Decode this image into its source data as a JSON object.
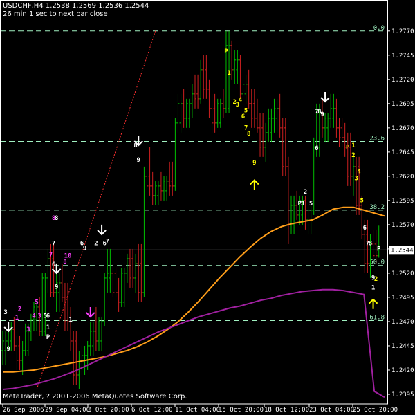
{
  "header": {
    "symbol_line": "USDCHF,H4  1.2538 1.2569 1.2536 1.2544",
    "timer": "26 min 1 sec to next bar close"
  },
  "footer": {
    "copyright": "MetaTrader, ? 2001-2006 MetaQuotes Software Corp."
  },
  "colors": {
    "background": "#000000",
    "grid": "#ffffff",
    "bull_bar": "#00c000",
    "bear_bar": "#d02020",
    "ma_fast": "#ff9e1a",
    "ma_slow": "#a020a0",
    "fib_line": "#a0f0c0",
    "trendline": "#ff3030",
    "label_yellow": "#ffff00",
    "label_white": "#ffffff",
    "label_magenta": "#ff40ff"
  },
  "chart_data": {
    "type": "candlestick",
    "symbol": "USDCHF",
    "timeframe": "H4",
    "current_price": "1.2544",
    "ylim": [
      1.2385,
      1.2782
    ],
    "y_ticks": [
      "1.2770",
      "1.2745",
      "1.2720",
      "1.2695",
      "1.2670",
      "1.2645",
      "1.2620",
      "1.2595",
      "1.2570",
      "1.2545",
      "1.2520",
      "1.2495",
      "1.2470",
      "1.2445",
      "1.2420",
      "1.2395"
    ],
    "x_ticks": [
      "26 Sep 2006",
      "29 Sep 04:00",
      "3 Oct 20:00",
      "6 Oct 12:00",
      "11 Oct 04:00",
      "15 Oct 20:00",
      "18 Oct 12:00",
      "23 Oct 04:00",
      "25 Oct 20:00"
    ],
    "fibonacci_levels": [
      {
        "label": "0.0",
        "price": 1.277
      },
      {
        "label": "23.6",
        "price": 1.2656
      },
      {
        "label": "38.2",
        "price": 1.2585
      },
      {
        "label": "50.0",
        "price": 1.2528
      },
      {
        "label": "61.8",
        "price": 1.2471
      }
    ],
    "current_price_line": 1.2544,
    "bars": [
      {
        "o": 1.244,
        "h": 1.246,
        "l": 1.2425,
        "c": 1.245
      },
      {
        "o": 1.245,
        "h": 1.247,
        "l": 1.244,
        "c": 1.2462
      },
      {
        "o": 1.2462,
        "h": 1.2475,
        "l": 1.244,
        "c": 1.2445
      },
      {
        "o": 1.2445,
        "h": 1.2455,
        "l": 1.242,
        "c": 1.243
      },
      {
        "o": 1.243,
        "h": 1.245,
        "l": 1.2415,
        "c": 1.244
      },
      {
        "o": 1.244,
        "h": 1.2468,
        "l": 1.2435,
        "c": 1.246
      },
      {
        "o": 1.246,
        "h": 1.2478,
        "l": 1.245,
        "c": 1.2472
      },
      {
        "o": 1.2472,
        "h": 1.249,
        "l": 1.246,
        "c": 1.2485
      },
      {
        "o": 1.2485,
        "h": 1.2495,
        "l": 1.2455,
        "c": 1.246
      },
      {
        "o": 1.246,
        "h": 1.252,
        "l": 1.2455,
        "c": 1.2515
      },
      {
        "o": 1.2515,
        "h": 1.2545,
        "l": 1.25,
        "c": 1.2535
      },
      {
        "o": 1.2535,
        "h": 1.255,
        "l": 1.2495,
        "c": 1.25
      },
      {
        "o": 1.25,
        "h": 1.252,
        "l": 1.248,
        "c": 1.251
      },
      {
        "o": 1.251,
        "h": 1.253,
        "l": 1.249,
        "c": 1.2495
      },
      {
        "o": 1.2495,
        "h": 1.251,
        "l": 1.246,
        "c": 1.247
      },
      {
        "o": 1.247,
        "h": 1.2485,
        "l": 1.244,
        "c": 1.245
      },
      {
        "o": 1.245,
        "h": 1.246,
        "l": 1.2405,
        "c": 1.2415
      },
      {
        "o": 1.2415,
        "h": 1.244,
        "l": 1.24,
        "c": 1.243
      },
      {
        "o": 1.243,
        "h": 1.2445,
        "l": 1.2415,
        "c": 1.2435
      },
      {
        "o": 1.2435,
        "h": 1.245,
        "l": 1.242,
        "c": 1.2445
      },
      {
        "o": 1.2445,
        "h": 1.247,
        "l": 1.2435,
        "c": 1.246
      },
      {
        "o": 1.246,
        "h": 1.2485,
        "l": 1.244,
        "c": 1.245
      },
      {
        "o": 1.245,
        "h": 1.2475,
        "l": 1.244,
        "c": 1.247
      },
      {
        "o": 1.247,
        "h": 1.252,
        "l": 1.2465,
        "c": 1.2515
      },
      {
        "o": 1.2515,
        "h": 1.2545,
        "l": 1.25,
        "c": 1.252
      },
      {
        "o": 1.252,
        "h": 1.253,
        "l": 1.2495,
        "c": 1.25
      },
      {
        "o": 1.25,
        "h": 1.2515,
        "l": 1.248,
        "c": 1.249
      },
      {
        "o": 1.249,
        "h": 1.2525,
        "l": 1.2485,
        "c": 1.252
      },
      {
        "o": 1.252,
        "h": 1.254,
        "l": 1.251,
        "c": 1.2535
      },
      {
        "o": 1.2535,
        "h": 1.2545,
        "l": 1.2505,
        "c": 1.2515
      },
      {
        "o": 1.2515,
        "h": 1.254,
        "l": 1.25,
        "c": 1.253
      },
      {
        "o": 1.253,
        "h": 1.255,
        "l": 1.249,
        "c": 1.25
      },
      {
        "o": 1.25,
        "h": 1.263,
        "l": 1.2495,
        "c": 1.262
      },
      {
        "o": 1.262,
        "h": 1.265,
        "l": 1.26,
        "c": 1.261
      },
      {
        "o": 1.261,
        "h": 1.2625,
        "l": 1.259,
        "c": 1.26
      },
      {
        "o": 1.26,
        "h": 1.2615,
        "l": 1.259,
        "c": 1.261
      },
      {
        "o": 1.261,
        "h": 1.2625,
        "l": 1.2595,
        "c": 1.2605
      },
      {
        "o": 1.2605,
        "h": 1.262,
        "l": 1.2595,
        "c": 1.2615
      },
      {
        "o": 1.2615,
        "h": 1.2635,
        "l": 1.26,
        "c": 1.261
      },
      {
        "o": 1.261,
        "h": 1.268,
        "l": 1.2605,
        "c": 1.2675
      },
      {
        "o": 1.2675,
        "h": 1.2705,
        "l": 1.2665,
        "c": 1.2695
      },
      {
        "o": 1.2695,
        "h": 1.271,
        "l": 1.267,
        "c": 1.268
      },
      {
        "o": 1.268,
        "h": 1.27,
        "l": 1.267,
        "c": 1.2695
      },
      {
        "o": 1.2695,
        "h": 1.2715,
        "l": 1.268,
        "c": 1.2705
      },
      {
        "o": 1.2705,
        "h": 1.2725,
        "l": 1.269,
        "c": 1.27
      },
      {
        "o": 1.27,
        "h": 1.274,
        "l": 1.2695,
        "c": 1.273
      },
      {
        "o": 1.273,
        "h": 1.2745,
        "l": 1.27,
        "c": 1.271
      },
      {
        "o": 1.271,
        "h": 1.272,
        "l": 1.268,
        "c": 1.269
      },
      {
        "o": 1.269,
        "h": 1.2705,
        "l": 1.2665,
        "c": 1.2675
      },
      {
        "o": 1.2675,
        "h": 1.27,
        "l": 1.267,
        "c": 1.2695
      },
      {
        "o": 1.2695,
        "h": 1.271,
        "l": 1.268,
        "c": 1.269
      },
      {
        "o": 1.269,
        "h": 1.277,
        "l": 1.2685,
        "c": 1.2755
      },
      {
        "o": 1.2755,
        "h": 1.276,
        "l": 1.272,
        "c": 1.273
      },
      {
        "o": 1.273,
        "h": 1.275,
        "l": 1.2715,
        "c": 1.274
      },
      {
        "o": 1.274,
        "h": 1.2745,
        "l": 1.27,
        "c": 1.2705
      },
      {
        "o": 1.2705,
        "h": 1.2725,
        "l": 1.2695,
        "c": 1.2715
      },
      {
        "o": 1.2715,
        "h": 1.273,
        "l": 1.269,
        "c": 1.2695
      },
      {
        "o": 1.2695,
        "h": 1.271,
        "l": 1.267,
        "c": 1.268
      },
      {
        "o": 1.268,
        "h": 1.27,
        "l": 1.2665,
        "c": 1.267
      },
      {
        "o": 1.267,
        "h": 1.2685,
        "l": 1.264,
        "c": 1.265
      },
      {
        "o": 1.265,
        "h": 1.2675,
        "l": 1.2635,
        "c": 1.2665
      },
      {
        "o": 1.2665,
        "h": 1.269,
        "l": 1.2655,
        "c": 1.268
      },
      {
        "o": 1.268,
        "h": 1.27,
        "l": 1.2665,
        "c": 1.269
      },
      {
        "o": 1.269,
        "h": 1.2705,
        "l": 1.266,
        "c": 1.267
      },
      {
        "o": 1.267,
        "h": 1.268,
        "l": 1.262,
        "c": 1.263
      },
      {
        "o": 1.263,
        "h": 1.264,
        "l": 1.255,
        "c": 1.257
      },
      {
        "o": 1.257,
        "h": 1.26,
        "l": 1.256,
        "c": 1.259
      },
      {
        "o": 1.259,
        "h": 1.2605,
        "l": 1.2575,
        "c": 1.258
      },
      {
        "o": 1.258,
        "h": 1.26,
        "l": 1.257,
        "c": 1.2595
      },
      {
        "o": 1.2595,
        "h": 1.26,
        "l": 1.2565,
        "c": 1.2575
      },
      {
        "o": 1.2575,
        "h": 1.259,
        "l": 1.256,
        "c": 1.2585
      },
      {
        "o": 1.2585,
        "h": 1.266,
        "l": 1.258,
        "c": 1.265
      },
      {
        "o": 1.265,
        "h": 1.2695,
        "l": 1.264,
        "c": 1.2685
      },
      {
        "o": 1.2685,
        "h": 1.27,
        "l": 1.266,
        "c": 1.267
      },
      {
        "o": 1.267,
        "h": 1.2685,
        "l": 1.2655,
        "c": 1.268
      },
      {
        "o": 1.268,
        "h": 1.2705,
        "l": 1.267,
        "c": 1.269
      },
      {
        "o": 1.269,
        "h": 1.27,
        "l": 1.266,
        "c": 1.267
      },
      {
        "o": 1.267,
        "h": 1.268,
        "l": 1.265,
        "c": 1.266
      },
      {
        "o": 1.266,
        "h": 1.2675,
        "l": 1.264,
        "c": 1.265
      },
      {
        "o": 1.265,
        "h": 1.2665,
        "l": 1.261,
        "c": 1.262
      },
      {
        "o": 1.262,
        "h": 1.264,
        "l": 1.26,
        "c": 1.263
      },
      {
        "o": 1.263,
        "h": 1.264,
        "l": 1.258,
        "c": 1.259
      },
      {
        "o": 1.259,
        "h": 1.26,
        "l": 1.2555,
        "c": 1.256
      },
      {
        "o": 1.256,
        "h": 1.2575,
        "l": 1.252,
        "c": 1.253
      },
      {
        "o": 1.253,
        "h": 1.256,
        "l": 1.2515,
        "c": 1.255
      },
      {
        "o": 1.255,
        "h": 1.2565,
        "l": 1.253,
        "c": 1.2538
      },
      {
        "o": 1.2538,
        "h": 1.2569,
        "l": 1.2536,
        "c": 1.2544
      }
    ],
    "ma_fast": [
      1.2418,
      1.2418,
      1.2419,
      1.242,
      1.2422,
      1.2424,
      1.2426,
      1.2428,
      1.243,
      1.2432,
      1.2434,
      1.2437,
      1.244,
      1.2444,
      1.2449,
      1.2455,
      1.2462,
      1.247,
      1.248,
      1.2491,
      1.2503,
      1.2515,
      1.2526,
      1.2537,
      1.2547,
      1.2556,
      1.2563,
      1.2568,
      1.2571,
      1.2573,
      1.2575,
      1.258,
      1.2586,
      1.2588,
      1.2588,
      1.2585,
      1.2582,
      1.2579
    ],
    "ma_slow": [
      1.24,
      1.2401,
      1.2403,
      1.2405,
      1.2408,
      1.2411,
      1.2415,
      1.2419,
      1.2424,
      1.2429,
      1.2434,
      1.2439,
      1.2444,
      1.2449,
      1.2454,
      1.2459,
      1.2463,
      1.2467,
      1.2471,
      1.2475,
      1.2478,
      1.2481,
      1.2484,
      1.2486,
      1.2489,
      1.2492,
      1.2494,
      1.2497,
      1.2499,
      1.2501,
      1.2502,
      1.2503,
      1.2503,
      1.2502,
      1.25,
      1.2498,
      1.2398,
      1.2392
    ],
    "annotations": [
      {
        "text": "3",
        "color": "white",
        "x": 1,
        "price": 1.2478
      },
      {
        "text": "9",
        "color": "white",
        "x": 2,
        "price": 1.244
      },
      {
        "text": "1",
        "color": "magenta",
        "x": 5,
        "price": 1.2472
      },
      {
        "text": "2",
        "color": "magenta",
        "x": 6,
        "price": 1.2481
      },
      {
        "text": "3",
        "color": "magenta",
        "x": 9,
        "price": 1.246
      },
      {
        "text": "4",
        "color": "magenta",
        "x": 11,
        "price": 1.2474
      },
      {
        "text": "5",
        "color": "magenta",
        "x": 12,
        "price": 1.2488
      },
      {
        "text": "3",
        "color": "magenta",
        "x": 13,
        "price": 1.2474
      },
      {
        "text": "5",
        "color": "white",
        "x": 15,
        "price": 1.2474
      },
      {
        "text": "6",
        "color": "white",
        "x": 16,
        "price": 1.2474
      },
      {
        "text": "1",
        "color": "white",
        "x": 16,
        "price": 1.2462
      },
      {
        "text": "P",
        "color": "white",
        "x": 16,
        "price": 1.2452
      },
      {
        "text": "7",
        "color": "magenta",
        "x": 17,
        "price": 1.2537
      },
      {
        "text": "8",
        "color": "magenta",
        "x": 18,
        "price": 1.2575
      },
      {
        "text": "8",
        "color": "white",
        "x": 19,
        "price": 1.2575
      },
      {
        "text": "7",
        "color": "white",
        "x": 18,
        "price": 1.2549
      },
      {
        "text": "6",
        "color": "white",
        "x": 18,
        "price": 1.2527
      },
      {
        "text": "9",
        "color": "white",
        "x": 19,
        "price": 1.2504
      },
      {
        "text": "8",
        "color": "magenta",
        "x": 22,
        "price": 1.253
      },
      {
        "text": "10",
        "color": "magenta",
        "x": 23,
        "price": 1.2536
      },
      {
        "text": "1",
        "color": "white",
        "x": 24,
        "price": 1.247
      },
      {
        "text": "6",
        "color": "white",
        "x": 28,
        "price": 1.2549
      },
      {
        "text": "9",
        "color": "white",
        "x": 29,
        "price": 1.2544
      },
      {
        "text": "2",
        "color": "white",
        "x": 33,
        "price": 1.2549
      },
      {
        "text": "6",
        "color": "white",
        "x": 36,
        "price": 1.2549
      },
      {
        "text": "7",
        "color": "white",
        "x": 37,
        "price": 1.2551
      },
      {
        "text": "8",
        "color": "white",
        "x": 47,
        "price": 1.265
      },
      {
        "text": "9",
        "color": "white",
        "x": 48,
        "price": 1.2635
      },
      {
        "text": "P",
        "color": "yellow",
        "x": 79,
        "price": 1.2747
      },
      {
        "text": "1",
        "color": "yellow",
        "x": 80,
        "price": 1.2725
      },
      {
        "text": "2",
        "color": "yellow",
        "x": 82,
        "price": 1.2695
      },
      {
        "text": "3",
        "color": "yellow",
        "x": 83,
        "price": 1.2692
      },
      {
        "text": "4",
        "color": "yellow",
        "x": 84,
        "price": 1.2697
      },
      {
        "text": "5",
        "color": "yellow",
        "x": 86,
        "price": 1.2686
      },
      {
        "text": "6",
        "color": "yellow",
        "x": 85,
        "price": 1.268
      },
      {
        "text": "7",
        "color": "yellow",
        "x": 86,
        "price": 1.2668
      },
      {
        "text": "8",
        "color": "yellow",
        "x": 87,
        "price": 1.2662
      },
      {
        "text": "9",
        "color": "yellow",
        "x": 89,
        "price": 1.2632
      },
      {
        "text": "2",
        "color": "white",
        "x": 107,
        "price": 1.2602
      },
      {
        "text": "P",
        "color": "white",
        "x": 105,
        "price": 1.259
      },
      {
        "text": "3",
        "color": "white",
        "x": 106,
        "price": 1.259
      },
      {
        "text": "5",
        "color": "white",
        "x": 109,
        "price": 1.259
      },
      {
        "text": "6",
        "color": "white",
        "x": 111,
        "price": 1.2647
      },
      {
        "text": "7",
        "color": "white",
        "x": 111,
        "price": 1.2685
      },
      {
        "text": "8",
        "color": "white",
        "x": 112,
        "price": 1.2685
      },
      {
        "text": "9",
        "color": "white",
        "x": 113,
        "price": 1.2682
      },
      {
        "text": "P",
        "color": "yellow",
        "x": 122,
        "price": 1.2648
      },
      {
        "text": "1",
        "color": "yellow",
        "x": 124,
        "price": 1.265
      },
      {
        "text": "2",
        "color": "yellow",
        "x": 124,
        "price": 1.264
      },
      {
        "text": "3",
        "color": "yellow",
        "x": 125,
        "price": 1.2616
      },
      {
        "text": "4",
        "color": "yellow",
        "x": 126,
        "price": 1.2623
      },
      {
        "text": "5",
        "color": "yellow",
        "x": 127,
        "price": 1.2593
      },
      {
        "text": "6",
        "color": "white",
        "x": 128,
        "price": 1.2565
      },
      {
        "text": "7",
        "color": "white",
        "x": 129,
        "price": 1.2549
      },
      {
        "text": "8",
        "color": "white",
        "x": 130,
        "price": 1.2549
      },
      {
        "text": "P",
        "color": "white",
        "x": 133,
        "price": 1.2543
      },
      {
        "text": "9",
        "color": "white",
        "x": 131,
        "price": 1.2513
      },
      {
        "text": "2",
        "color": "yellow",
        "x": 132,
        "price": 1.2512
      },
      {
        "text": "1",
        "color": "white",
        "x": 131,
        "price": 1.2503
      }
    ],
    "arrows": [
      {
        "dir": "down",
        "color": "white",
        "x": 2,
        "price": 1.246
      },
      {
        "dir": "down",
        "color": "white",
        "x": 19,
        "price": 1.252
      },
      {
        "dir": "down",
        "color": "magenta",
        "x": 31,
        "price": 1.2475
      },
      {
        "dir": "down",
        "color": "white",
        "x": 35,
        "price": 1.256
      },
      {
        "dir": "down",
        "color": "white",
        "x": 48,
        "price": 1.2652
      },
      {
        "dir": "up",
        "color": "yellow",
        "x": 89,
        "price": 1.2616
      },
      {
        "dir": "down",
        "color": "white",
        "x": 114,
        "price": 1.2697
      },
      {
        "dir": "up",
        "color": "yellow",
        "x": 131,
        "price": 1.2493
      }
    ]
  }
}
